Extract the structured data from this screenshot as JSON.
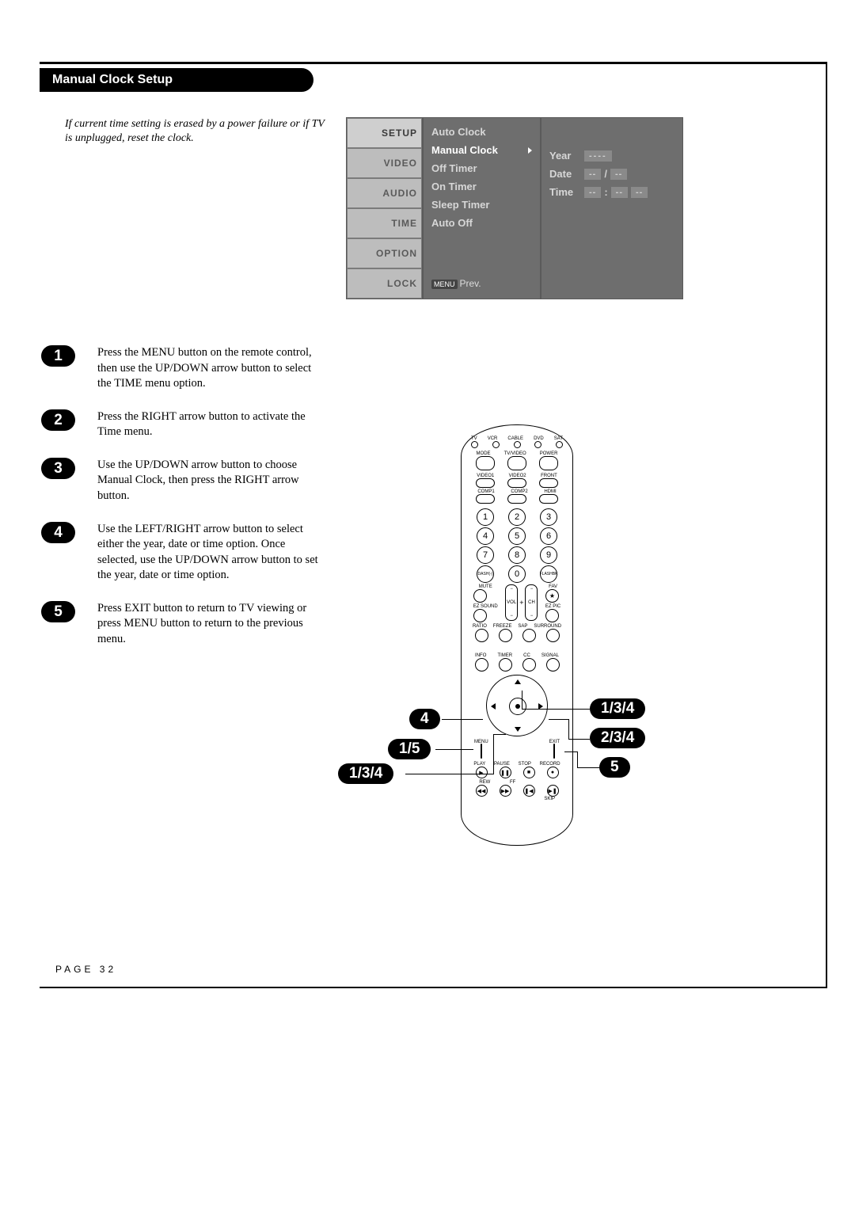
{
  "section_title": "Manual Clock Setup",
  "intro": "If current time setting is erased by a power failure or if TV is unplugged, reset the clock.",
  "osd_left": {
    "items": [
      "SETUP",
      "VIDEO",
      "AUDIO",
      "TIME",
      "OPTION",
      "LOCK"
    ]
  },
  "osd_mid": {
    "items": [
      "Auto Clock",
      "Manual Clock",
      "Off Timer",
      "On Timer",
      "Sleep Timer",
      "Auto Off"
    ],
    "prev_label": "Prev.",
    "prev_badge": "MENU"
  },
  "osd_right": {
    "year_label": "Year",
    "year_value": "----",
    "date_label": "Date",
    "date_value_a": "--",
    "date_sep": "/",
    "date_value_b": "--",
    "time_label": "Time",
    "time_value_h": "--",
    "time_sep": ":",
    "time_value_m": "--",
    "time_value_ampm": "--"
  },
  "steps": [
    {
      "n": "1",
      "text": "Press the MENU button on the remote control, then use the UP/DOWN arrow button to select the TIME menu option."
    },
    {
      "n": "2",
      "text": "Press the RIGHT arrow button to activate the Time menu."
    },
    {
      "n": "3",
      "text": "Use the UP/DOWN arrow button to choose Manual Clock, then press the RIGHT arrow button."
    },
    {
      "n": "4",
      "text": "Use the LEFT/RIGHT arrow button to select either the year, date or time option. Once selected, use the UP/DOWN arrow button to set the year, date or time option."
    },
    {
      "n": "5",
      "text": "Press EXIT button to return to TV viewing or press MENU button to return to the previous menu."
    }
  ],
  "remote": {
    "dev_labels": [
      "TV",
      "VCR",
      "CABLE",
      "DVD",
      "SAT"
    ],
    "row_a": [
      "MODE",
      "TV/VIDEO",
      "POWER"
    ],
    "row_b": [
      "VIDEO1",
      "VIDEO2",
      "FRONT"
    ],
    "row_c": [
      "COMP1",
      "COMP2",
      "HDMI"
    ],
    "nums": [
      "1",
      "2",
      "3",
      "4",
      "5",
      "6",
      "7",
      "8",
      "9",
      "DASH(-)",
      "0",
      "FLASHBK"
    ],
    "mute": "MUTE",
    "fav": "FAV",
    "ezsound": "EZ SOUND",
    "ezpic": "EZ PIC",
    "vol": "VOL",
    "ch": "CH",
    "row_d": [
      "RATIO",
      "FREEZE",
      "SAP",
      "SURROUND"
    ],
    "row_e": [
      "INFO",
      "TIMER",
      "CC",
      "SIGNAL"
    ],
    "menu": "MENU",
    "exit": "EXIT",
    "transport_a": [
      "PLAY",
      "PAUSE",
      "STOP",
      "RECORD"
    ],
    "transport_b": [
      "REW",
      "FF",
      "",
      ""
    ],
    "skip": "SKIP"
  },
  "callouts": {
    "left_top": "4",
    "left_mid": "1/5",
    "left_bot": "1/3/4",
    "right_top": "1/3/4",
    "right_mid": "2/3/4",
    "right_bot": "5"
  },
  "page_number": "PAGE 32"
}
